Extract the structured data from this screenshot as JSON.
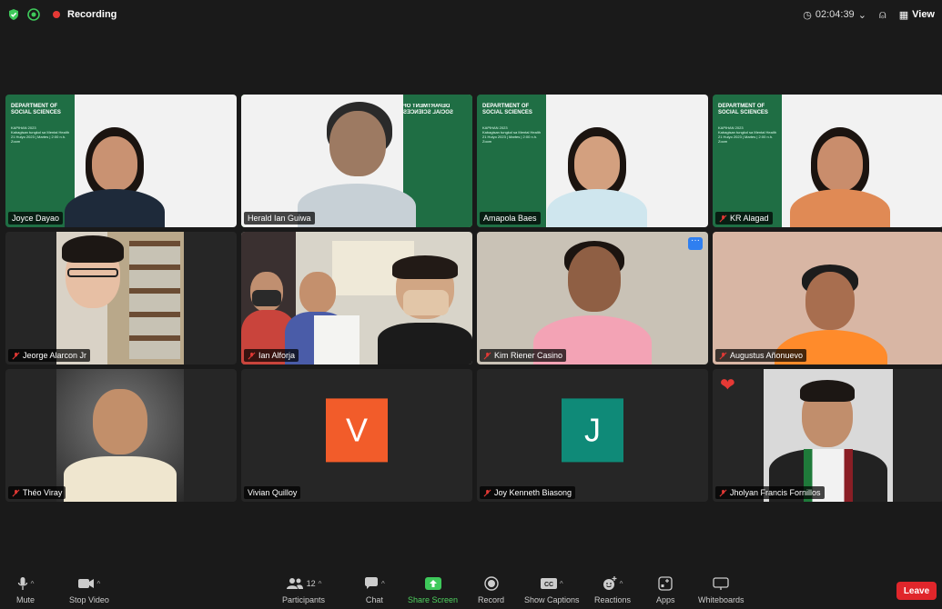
{
  "topbar": {
    "recording_label": "Recording",
    "timer": "02:04:39",
    "view_label": "View"
  },
  "vbg": {
    "title": "DEPARTMENT OF SOCIAL SCIENCES",
    "line1": "KAPIHAN 2023",
    "line2": "Kabagisan tungkol sa Mental Health",
    "line3": "21 Hulyo 2023 | Martes | 2:00 n.h.",
    "line4": "Zoom"
  },
  "participants": [
    {
      "name": "Joyce Dayao",
      "muted": false
    },
    {
      "name": "Herald Ian Guiwa",
      "muted": false
    },
    {
      "name": "Amapola Baes",
      "muted": false
    },
    {
      "name": "KR Alagad",
      "muted": true
    },
    {
      "name": "Jeorge Alarcon Jr",
      "muted": true
    },
    {
      "name": "Ian Alforja",
      "muted": true
    },
    {
      "name": "Kim Riener Casino",
      "muted": true
    },
    {
      "name": "Augustus Añonuevo",
      "muted": true
    },
    {
      "name": "Théo Viray",
      "muted": true
    },
    {
      "name": "Vivian Quilloy",
      "muted": false,
      "initial": "V",
      "color": "#f25c2a"
    },
    {
      "name": "Joy Kenneth Biasong",
      "muted": true,
      "initial": "J",
      "color": "#0f8a78"
    },
    {
      "name": "Jholyan Francis Fornillos",
      "muted": true
    }
  ],
  "toolbar": {
    "mute": "Mute",
    "stop_video": "Stop Video",
    "participants": "Participants",
    "participants_count": "12",
    "chat": "Chat",
    "share_screen": "Share Screen",
    "record": "Record",
    "show_captions": "Show Captions",
    "reactions": "Reactions",
    "apps": "Apps",
    "whiteboards": "Whiteboards",
    "leave": "Leave"
  },
  "colors": {
    "accent_green": "#4fd05f",
    "leave_red": "#e0262b",
    "active_speaker": "#5ee35e"
  }
}
